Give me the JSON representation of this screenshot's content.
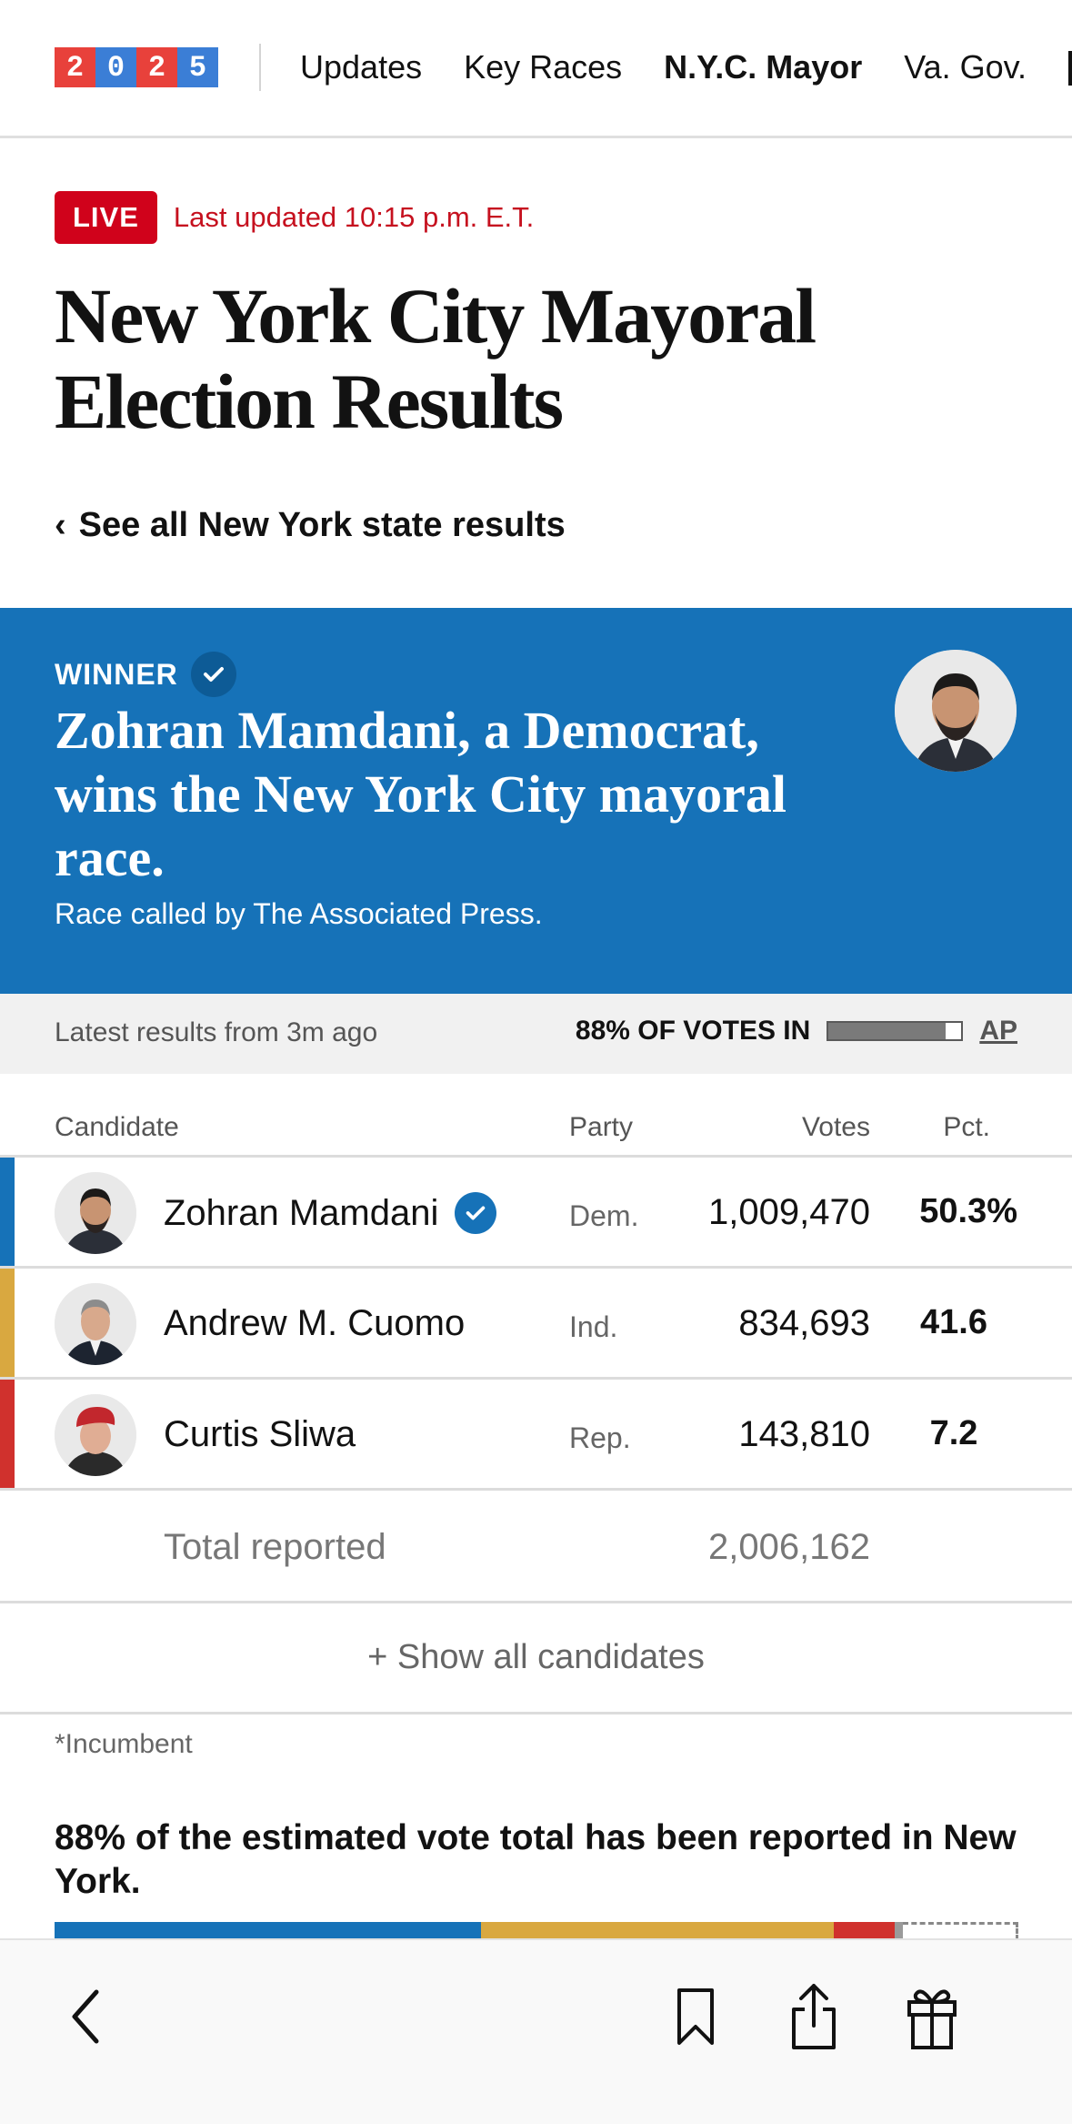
{
  "nav": {
    "logo_digits": [
      "2",
      "0",
      "2",
      "5"
    ],
    "logo_colors": [
      "#e8413b",
      "#3b7ed6",
      "#e8413b",
      "#3b7ed6"
    ],
    "items": [
      {
        "label": "Updates",
        "active": false
      },
      {
        "label": "Key Races",
        "active": false
      },
      {
        "label": "N.Y.C. Mayor",
        "active": true
      },
      {
        "label": "Va. Gov.",
        "active": false
      }
    ]
  },
  "live": {
    "badge": "LIVE",
    "updated": "Last updated 10:15 p.m. E.T."
  },
  "page": {
    "title": "New York City Mayoral Election Results",
    "back_link": "See all New York state results"
  },
  "winner": {
    "label": "WINNER",
    "headline": "Zohran Mamdani, a Democrat, wins the New York City mayoral race.",
    "called_by": "Race called by The Associated Press."
  },
  "status": {
    "latest": "Latest results from 3m ago",
    "votes_in": "88% OF VOTES IN",
    "votes_in_fraction": 0.88,
    "source": "AP"
  },
  "table": {
    "headers": {
      "candidate": "Candidate",
      "party": "Party",
      "votes": "Votes",
      "pct": "Pct."
    },
    "rows": [
      {
        "name": "Zohran Mamdani",
        "party": "Dem.",
        "votes": "1,009,470",
        "pct": "50.3%",
        "color": "#1672b8",
        "winner": true
      },
      {
        "name": "Andrew M. Cuomo",
        "party": "Ind.",
        "votes": "834,693",
        "pct": "41.6",
        "color": "#d9a840",
        "winner": false
      },
      {
        "name": "Curtis Sliwa",
        "party": "Rep.",
        "votes": "143,810",
        "pct": "7.2",
        "color": "#d0312d",
        "winner": false
      }
    ],
    "total_label": "Total reported",
    "total_votes": "2,006,162",
    "show_all": "+ Show all candidates",
    "footnote": "*Incumbent"
  },
  "estimate": {
    "text": "88% of the estimated vote total has been reported in New York.",
    "segments": [
      {
        "share": 0.503,
        "color": "#1672b8"
      },
      {
        "share": 0.416,
        "color": "#d9a840"
      },
      {
        "share": 0.072,
        "color": "#d0312d"
      },
      {
        "share": 0.009,
        "color": "#9a9a9a"
      }
    ],
    "reported_fraction": 0.88
  },
  "toolbar": {
    "icons": [
      "back-icon",
      "bookmark-icon",
      "share-icon",
      "gift-icon"
    ]
  }
}
